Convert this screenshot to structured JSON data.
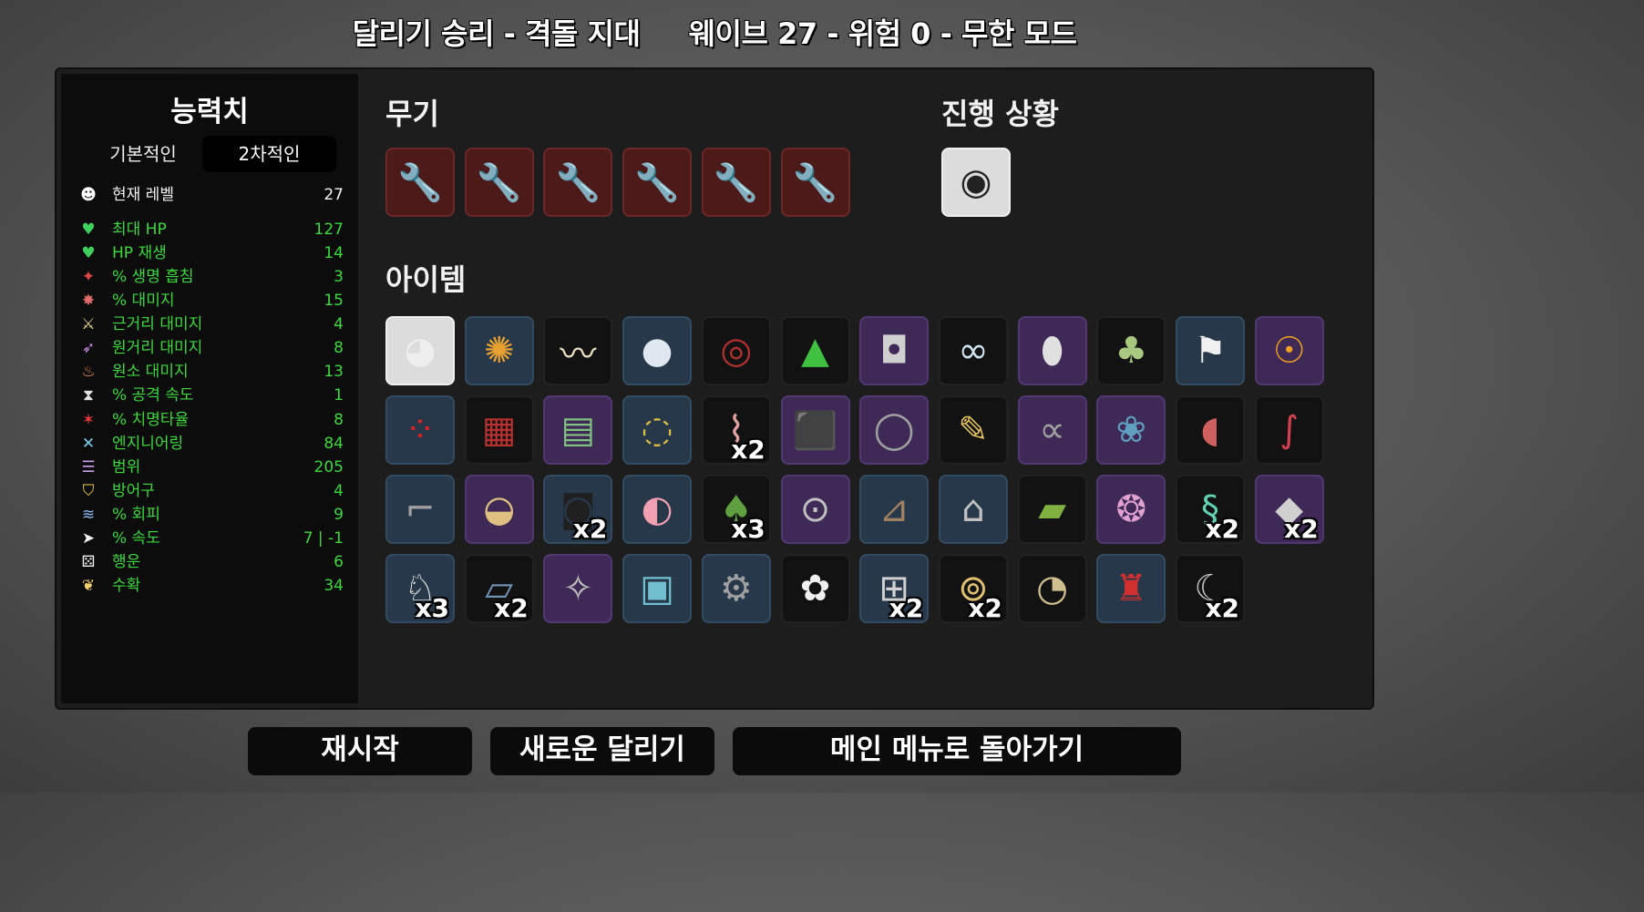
{
  "title": "달리기 승리 - 격돌 지대     웨이브 27 - 위험 0 - 무한 모드",
  "stats": {
    "title": "능력치",
    "tab_basic": "기본적인",
    "tab_secondary": "2차적인",
    "rows": [
      {
        "icon": "level-icon",
        "glyph": "☻",
        "label": "현재 레벨",
        "value": "27",
        "color": "white"
      },
      {
        "icon": "max-hp-icon",
        "glyph": "♥",
        "label": "최대 HP",
        "value": "127",
        "color": "green"
      },
      {
        "icon": "hp-regen-icon",
        "glyph": "♥",
        "label": "HP 재생",
        "value": "14",
        "color": "green"
      },
      {
        "icon": "life-steal-icon",
        "glyph": "✦",
        "label": "% 생명 흡침",
        "value": "3",
        "color": "green"
      },
      {
        "icon": "damage-icon",
        "glyph": "✸",
        "label": "% 대미지",
        "value": "15",
        "color": "green"
      },
      {
        "icon": "melee-damage-icon",
        "glyph": "⚔",
        "label": "근거리 대미지",
        "value": "4",
        "color": "green"
      },
      {
        "icon": "ranged-damage-icon",
        "glyph": "➶",
        "label": "원거리 대미지",
        "value": "8",
        "color": "green"
      },
      {
        "icon": "elemental-damage-icon",
        "glyph": "♨",
        "label": "원소 대미지",
        "value": "13",
        "color": "green"
      },
      {
        "icon": "attack-speed-icon",
        "glyph": "⧗",
        "label": "% 공격 속도",
        "value": "1",
        "color": "green"
      },
      {
        "icon": "crit-chance-icon",
        "glyph": "✶",
        "label": "% 치명타율",
        "value": "8",
        "color": "green"
      },
      {
        "icon": "engineering-icon",
        "glyph": "✕",
        "label": "엔지니어링",
        "value": "84",
        "color": "green"
      },
      {
        "icon": "range-icon",
        "glyph": "☰",
        "label": "범위",
        "value": "205",
        "color": "green"
      },
      {
        "icon": "armor-icon",
        "glyph": "⛉",
        "label": "방어구",
        "value": "4",
        "color": "green"
      },
      {
        "icon": "dodge-icon",
        "glyph": "≋",
        "label": "% 회피",
        "value": "9",
        "color": "green"
      },
      {
        "icon": "speed-icon",
        "glyph": "➤",
        "label": "% 속도",
        "value": "7 | -1",
        "color": "green"
      },
      {
        "icon": "luck-icon",
        "glyph": "⚄",
        "label": "행운",
        "value": "6",
        "color": "green"
      },
      {
        "icon": "harvesting-icon",
        "glyph": "❦",
        "label": "수확",
        "value": "34",
        "color": "green"
      }
    ]
  },
  "weapons": {
    "title": "무기",
    "items": [
      {
        "name": "wrench-icon",
        "glyph": "🔧",
        "rank": "weapon"
      },
      {
        "name": "wrench-icon",
        "glyph": "🔧",
        "rank": "weapon"
      },
      {
        "name": "wrench-icon",
        "glyph": "🔧",
        "rank": "weapon"
      },
      {
        "name": "wrench-icon",
        "glyph": "🔧",
        "rank": "weapon"
      },
      {
        "name": "wrench-icon",
        "glyph": "🔧",
        "rank": "weapon"
      },
      {
        "name": "wrench-icon",
        "glyph": "🔧",
        "rank": "weapon"
      }
    ]
  },
  "progress": {
    "title": "진행 상황",
    "items": [
      {
        "name": "engineer-character-icon",
        "glyph": "◉",
        "rank": "white"
      }
    ]
  },
  "items": {
    "title": "아이템",
    "list": [
      {
        "name": "angry-egg-icon",
        "glyph": "◕",
        "rank": "white",
        "count": ""
      },
      {
        "name": "wasp-icon",
        "glyph": "✺",
        "rank": "t2",
        "count": ""
      },
      {
        "name": "lizard-icon",
        "glyph": "〰",
        "rank": "t1",
        "count": ""
      },
      {
        "name": "snowball-icon",
        "glyph": "●",
        "rank": "t2",
        "count": ""
      },
      {
        "name": "landmine-icon",
        "glyph": "◎",
        "rank": "t1",
        "count": ""
      },
      {
        "name": "slime-icon",
        "glyph": "▲",
        "rank": "t1",
        "count": ""
      },
      {
        "name": "bucket-icon",
        "glyph": "◘",
        "rank": "t3",
        "count": ""
      },
      {
        "name": "goggles-icon",
        "glyph": "∞",
        "rank": "t1",
        "count": ""
      },
      {
        "name": "bottle-icon",
        "glyph": "⬮",
        "rank": "t3",
        "count": ""
      },
      {
        "name": "herb-sack-icon",
        "glyph": "♣",
        "rank": "t1",
        "count": ""
      },
      {
        "name": "white-flag-icon",
        "glyph": "⚑",
        "rank": "t2",
        "count": ""
      },
      {
        "name": "alien-drone-icon",
        "glyph": "☉",
        "rank": "t3",
        "count": ""
      },
      {
        "name": "bomb-cluster-icon",
        "glyph": "⁘",
        "rank": "t2",
        "count": ""
      },
      {
        "name": "plaid-shirt-icon",
        "glyph": "▦",
        "rank": "t1",
        "count": ""
      },
      {
        "name": "book-stack-icon",
        "glyph": "▤",
        "rank": "t3",
        "count": ""
      },
      {
        "name": "pendant-icon",
        "glyph": "◌",
        "rank": "t2",
        "count": ""
      },
      {
        "name": "shrimp-icon",
        "glyph": "⌇",
        "rank": "t1",
        "count": "x2"
      },
      {
        "name": "toolbox-icon",
        "glyph": "⬛",
        "rank": "t3",
        "count": ""
      },
      {
        "name": "ring-icon",
        "glyph": "◯",
        "rank": "t3",
        "count": ""
      },
      {
        "name": "pencil-icon",
        "glyph": "✎",
        "rank": "t1",
        "count": ""
      },
      {
        "name": "handcuffs-icon",
        "glyph": "∝",
        "rank": "t3",
        "count": ""
      },
      {
        "name": "peacock-icon",
        "glyph": "❀",
        "rank": "t3",
        "count": ""
      },
      {
        "name": "stomach-icon",
        "glyph": "◖",
        "rank": "t1",
        "count": ""
      },
      {
        "name": "serpent-tongue-icon",
        "glyph": "∫",
        "rank": "t1",
        "count": ""
      },
      {
        "name": "lamp-arm-icon",
        "glyph": "⌐",
        "rank": "t2",
        "count": ""
      },
      {
        "name": "noodle-bowl-icon",
        "glyph": "◒",
        "rank": "t3",
        "count": ""
      },
      {
        "name": "turret-icon",
        "glyph": "◙",
        "rank": "t2",
        "count": "x2"
      },
      {
        "name": "piggy-bank-icon",
        "glyph": "◐",
        "rank": "t2",
        "count": ""
      },
      {
        "name": "tree-icon",
        "glyph": "♠",
        "rank": "t1",
        "count": "x3"
      },
      {
        "name": "robot-icon",
        "glyph": "⊙",
        "rank": "t3",
        "count": ""
      },
      {
        "name": "wheelbarrow-icon",
        "glyph": "⊿",
        "rank": "t2",
        "count": ""
      },
      {
        "name": "factory-icon",
        "glyph": "⌂",
        "rank": "t2",
        "count": ""
      },
      {
        "name": "banknote-icon",
        "glyph": "▰",
        "rank": "t1",
        "count": ""
      },
      {
        "name": "brain-icon",
        "glyph": "❂",
        "rank": "t3",
        "count": ""
      },
      {
        "name": "ghost-worm-icon",
        "glyph": "§",
        "rank": "t1",
        "count": "x2"
      },
      {
        "name": "metal-plate-icon",
        "glyph": "◆",
        "rank": "t3",
        "count": "x2"
      },
      {
        "name": "rabbit-icon",
        "glyph": "♘",
        "rank": "t2",
        "count": "x3"
      },
      {
        "name": "blade-icon",
        "glyph": "▱",
        "rank": "t1",
        "count": "x2"
      },
      {
        "name": "screw-icon",
        "glyph": "✧",
        "rank": "t3",
        "count": ""
      },
      {
        "name": "gift-box-icon",
        "glyph": "▣",
        "rank": "t2",
        "count": ""
      },
      {
        "name": "gear-icon",
        "glyph": "⚙",
        "rank": "t2",
        "count": ""
      },
      {
        "name": "ghost-icon",
        "glyph": "✿",
        "rank": "t1",
        "count": ""
      },
      {
        "name": "barrel-icon",
        "glyph": "⊞",
        "rank": "t2",
        "count": "x2"
      },
      {
        "name": "camera-turret-icon",
        "glyph": "⊚",
        "rank": "t1",
        "count": "x2"
      },
      {
        "name": "bird-icon",
        "glyph": "◔",
        "rank": "t1",
        "count": ""
      },
      {
        "name": "red-cape-icon",
        "glyph": "♜",
        "rank": "t2",
        "count": ""
      },
      {
        "name": "claw-icon",
        "glyph": "☾",
        "rank": "t1",
        "count": "x2"
      }
    ]
  },
  "buttons": {
    "restart": "재시작",
    "new_run": "새로운 달리기",
    "main_menu": "메인 메뉴로 돌아가기"
  },
  "colors": {
    "stat_green": "#3dd83d",
    "weapon_bg": "#4d1a1a",
    "tier2_bg": "#26384a",
    "tier3_bg": "#3f2a57",
    "tier1_bg": "#121212"
  }
}
